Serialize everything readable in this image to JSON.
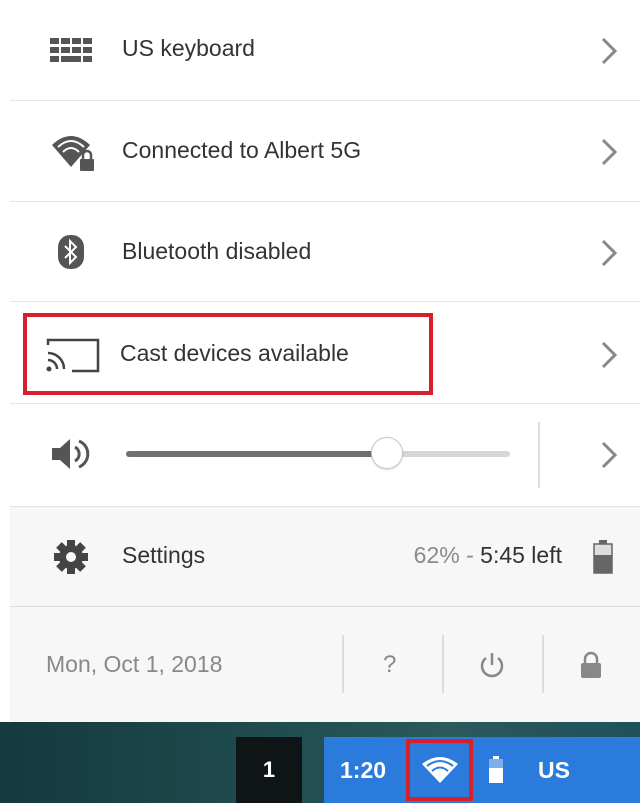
{
  "menu": {
    "keyboard": {
      "label": "US keyboard",
      "icon": "keyboard-icon"
    },
    "network": {
      "label": "Connected to Albert 5G",
      "icon": "wifi-lock-icon"
    },
    "bluetooth": {
      "label": "Bluetooth disabled",
      "icon": "bluetooth-icon"
    },
    "cast": {
      "label": "Cast devices available",
      "icon": "cast-icon"
    },
    "volume": {
      "icon": "speaker-icon",
      "level": 0.68
    }
  },
  "settings": {
    "label": "Settings",
    "battery_percent": "62%",
    "battery_sep": " - ",
    "battery_time": "5:45 left",
    "icon": "gear-icon"
  },
  "footer": {
    "date": "Mon, Oct 1, 2018",
    "help_label": "?",
    "icons": [
      "power-icon",
      "lock-icon"
    ]
  },
  "shelf": {
    "badge": "1",
    "time": "1:20",
    "ime": "US"
  },
  "colors": {
    "highlight": "#d8202a",
    "tray": "#2a7bdc",
    "accent_text": "#333333"
  }
}
